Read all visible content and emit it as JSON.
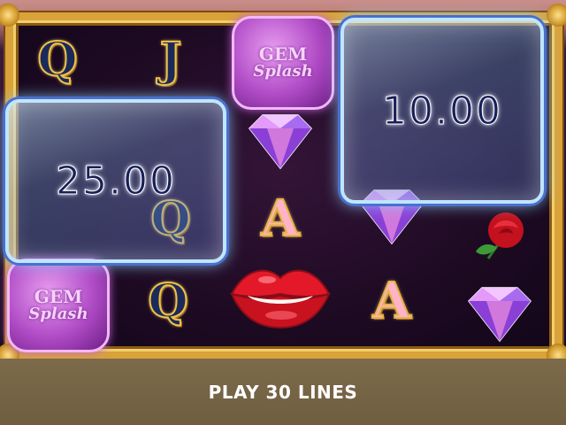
{
  "reels": {
    "letters": {
      "q": "Q",
      "j": "J",
      "a": "A"
    },
    "gem_badge": {
      "line1": "GEM",
      "line2": "Splash"
    }
  },
  "wins": {
    "left_box_value": "25.00",
    "right_box_value": "10.00"
  },
  "footer": {
    "label": "PLAY 30 LINES"
  },
  "colors": {
    "frame_gold": "#d9a23a",
    "footer_bg": "#6f5e40",
    "win_text": "#17205a"
  }
}
